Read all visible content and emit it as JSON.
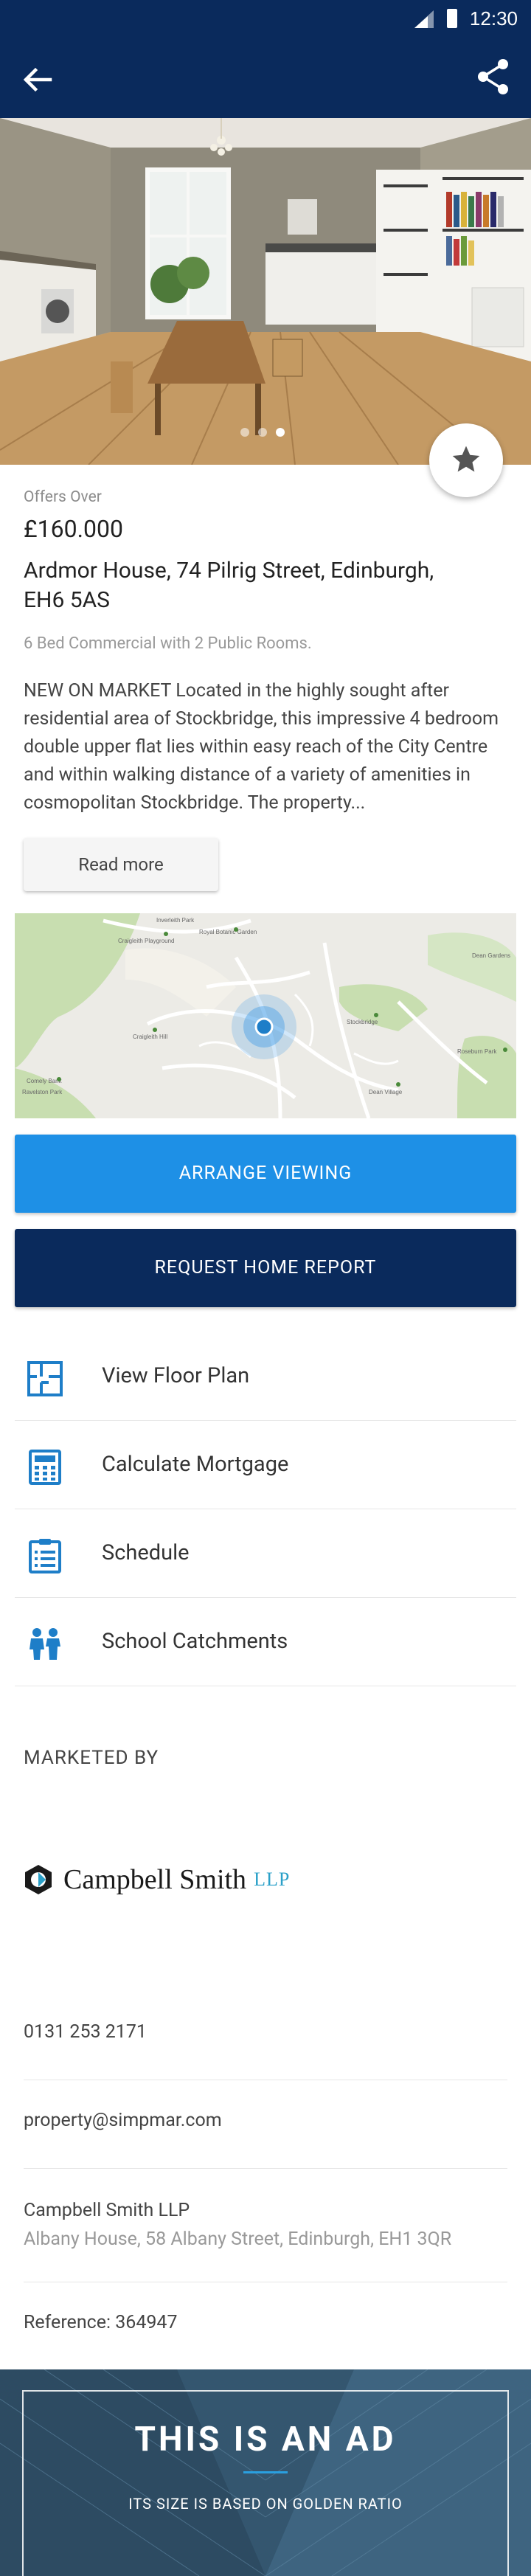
{
  "status_bar": {
    "time": "12:30"
  },
  "listing": {
    "offer_label": "Offers Over",
    "price": "£160.000",
    "address": "Ardmor House, 74 Pilrig Street, Edinburgh, EH6 5AS",
    "summary": "6 Bed Commercial with 2 Public Rooms.",
    "description": "NEW ON MARKET Located in the highly sought after residential area of Stockbridge, this impressive 4 bedroom double upper flat lies within easy reach of the City Centre and within walking distance of a variety of amenities in cosmopolitan Stockbridge. The property...",
    "read_more_label": "Read more",
    "carousel": {
      "count": 3,
      "active_index": 2
    }
  },
  "map": {
    "place_labels": [
      "Inverleith Park",
      "Royal Botanic Garden",
      "Craigleith Playground",
      "Craigleith Hill",
      "Comely Bank",
      "Ravelston Park",
      "Stockbridge",
      "Dean Village",
      "Dean Gardens",
      "Roseburn Park"
    ]
  },
  "actions": {
    "arrange_viewing": "ARRANGE VIEWING",
    "request_home_report": "REQUEST HOME REPORT"
  },
  "menu": [
    {
      "label": "View Floor Plan",
      "icon": "floor-plan-icon"
    },
    {
      "label": "Calculate Mortgage",
      "icon": "calculator-icon"
    },
    {
      "label": "Schedule",
      "icon": "clipboard-list-icon"
    },
    {
      "label": "School Catchments",
      "icon": "children-icon"
    }
  ],
  "agent": {
    "section_title": "MARKETED BY",
    "logo_name": "Campbell Smith",
    "logo_suffix": "LLP",
    "phone": "0131 253 2171",
    "email": "property@simpmar.com",
    "office_name": "Campbell Smith LLP",
    "office_address": "Albany House, 58 Albany Street, Edinburgh, EH1 3QR",
    "reference": "Reference: 364947"
  },
  "ad": {
    "headline": "THIS IS AN AD",
    "subline": "ITS SIZE IS BASED ON GOLDEN RATIO"
  },
  "colors": {
    "primary_navy": "#0a2a5c",
    "accent_blue": "#1e90e6",
    "icon_blue": "#1e7ec8"
  }
}
